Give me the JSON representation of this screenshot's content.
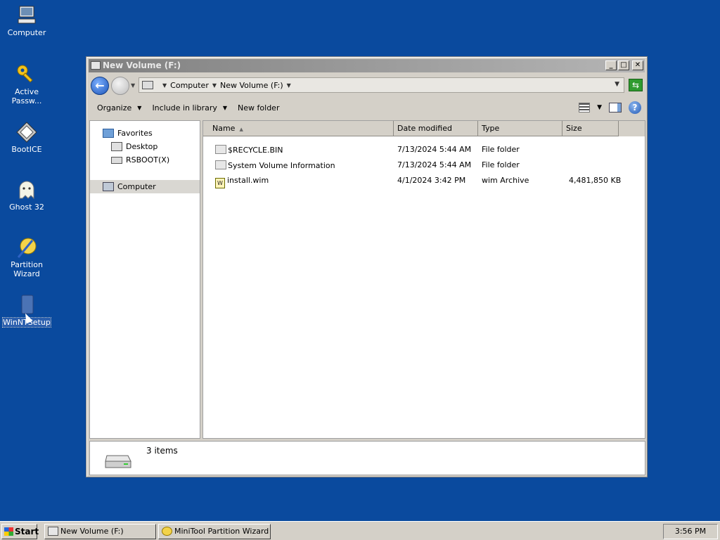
{
  "desktop": {
    "icons": [
      {
        "label": "Computer",
        "icon": "computer-icon"
      },
      {
        "label": "Active Passw...",
        "icon": "key-icon"
      },
      {
        "label": "BootICE",
        "icon": "bootice-icon"
      },
      {
        "label": "Ghost 32",
        "icon": "ghost-icon"
      },
      {
        "label": "Partition Wizard",
        "icon": "partition-wizard-icon"
      },
      {
        "label": "WinNTSetup",
        "icon": "winntsetup-icon"
      }
    ]
  },
  "window": {
    "title": "New Volume (F:)",
    "buttons": {
      "minimize": "_",
      "maximize": "□",
      "close": "✕"
    }
  },
  "address": {
    "crumbs": [
      "Computer",
      "New Volume (F:)"
    ]
  },
  "toolbar": {
    "organize": "Organize",
    "include": "Include in library",
    "new_folder": "New folder"
  },
  "navpane": {
    "favorites": "Favorites",
    "desktop": "Desktop",
    "rsboot": "RSBOOT(X)",
    "computer": "Computer"
  },
  "columns": {
    "name": "Name",
    "date": "Date modified",
    "type": "Type",
    "size": "Size"
  },
  "files": [
    {
      "name": "$RECYCLE.BIN",
      "date": "7/13/2024 5:44 AM",
      "type": "File folder",
      "size": "",
      "icon": "folder-icon"
    },
    {
      "name": "System Volume Information",
      "date": "7/13/2024 5:44 AM",
      "type": "File folder",
      "size": "",
      "icon": "folder-icon"
    },
    {
      "name": "install.wim",
      "date": "4/1/2024 3:42 PM",
      "type": "wim Archive",
      "size": "4,481,850 KB",
      "icon": "wim-file-icon"
    }
  ],
  "details": {
    "count": "3 items"
  },
  "taskbar": {
    "start": "Start",
    "tasks": [
      "New Volume (F:)",
      "MiniTool Partition Wizard ..."
    ],
    "clock": "3:56 PM"
  },
  "colors": {
    "desktop": "#0a4a9e",
    "chrome": "#d4d0c8"
  }
}
